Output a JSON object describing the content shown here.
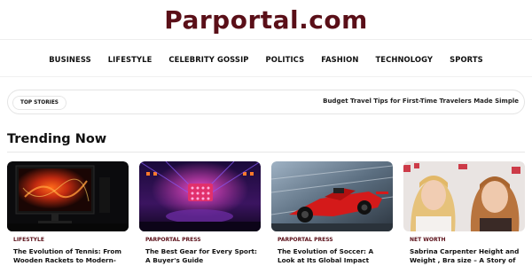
{
  "site": {
    "logo": "Parportal.com"
  },
  "nav": {
    "items": [
      {
        "label": "BUSINESS"
      },
      {
        "label": "LIFESTYLE"
      },
      {
        "label": "CELEBRITY GOSSIP"
      },
      {
        "label": "POLITICS"
      },
      {
        "label": "FASHION"
      },
      {
        "label": "TECHNOLOGY"
      },
      {
        "label": "SPORTS"
      }
    ]
  },
  "top_stories": {
    "badge": "TOP STORIES",
    "headline": "Budget Travel Tips for First-Time Travelers Made Simple"
  },
  "trending": {
    "heading": "Trending Now",
    "cards": [
      {
        "category": "LIFESTYLE",
        "title": "The Evolution of Tennis: From Wooden Rackets to Modern-Day",
        "image": "dark-monitor-fire-image"
      },
      {
        "category": "PARPORTAL PRESS",
        "title": "The Best Gear for Every Sport: A Buyer's Guide",
        "image": "neon-stage-image"
      },
      {
        "category": "PARPORTAL PRESS",
        "title": "The Evolution of Soccer: A Look at Its Global Impact",
        "image": "race-car-image"
      },
      {
        "category": "NET WORTH",
        "title": "Sabrina Carpenter Height and Weight , Bra size – A Story of Talent,",
        "image": "two-women-photo"
      }
    ]
  },
  "colors": {
    "brand": "#5a0f18"
  }
}
